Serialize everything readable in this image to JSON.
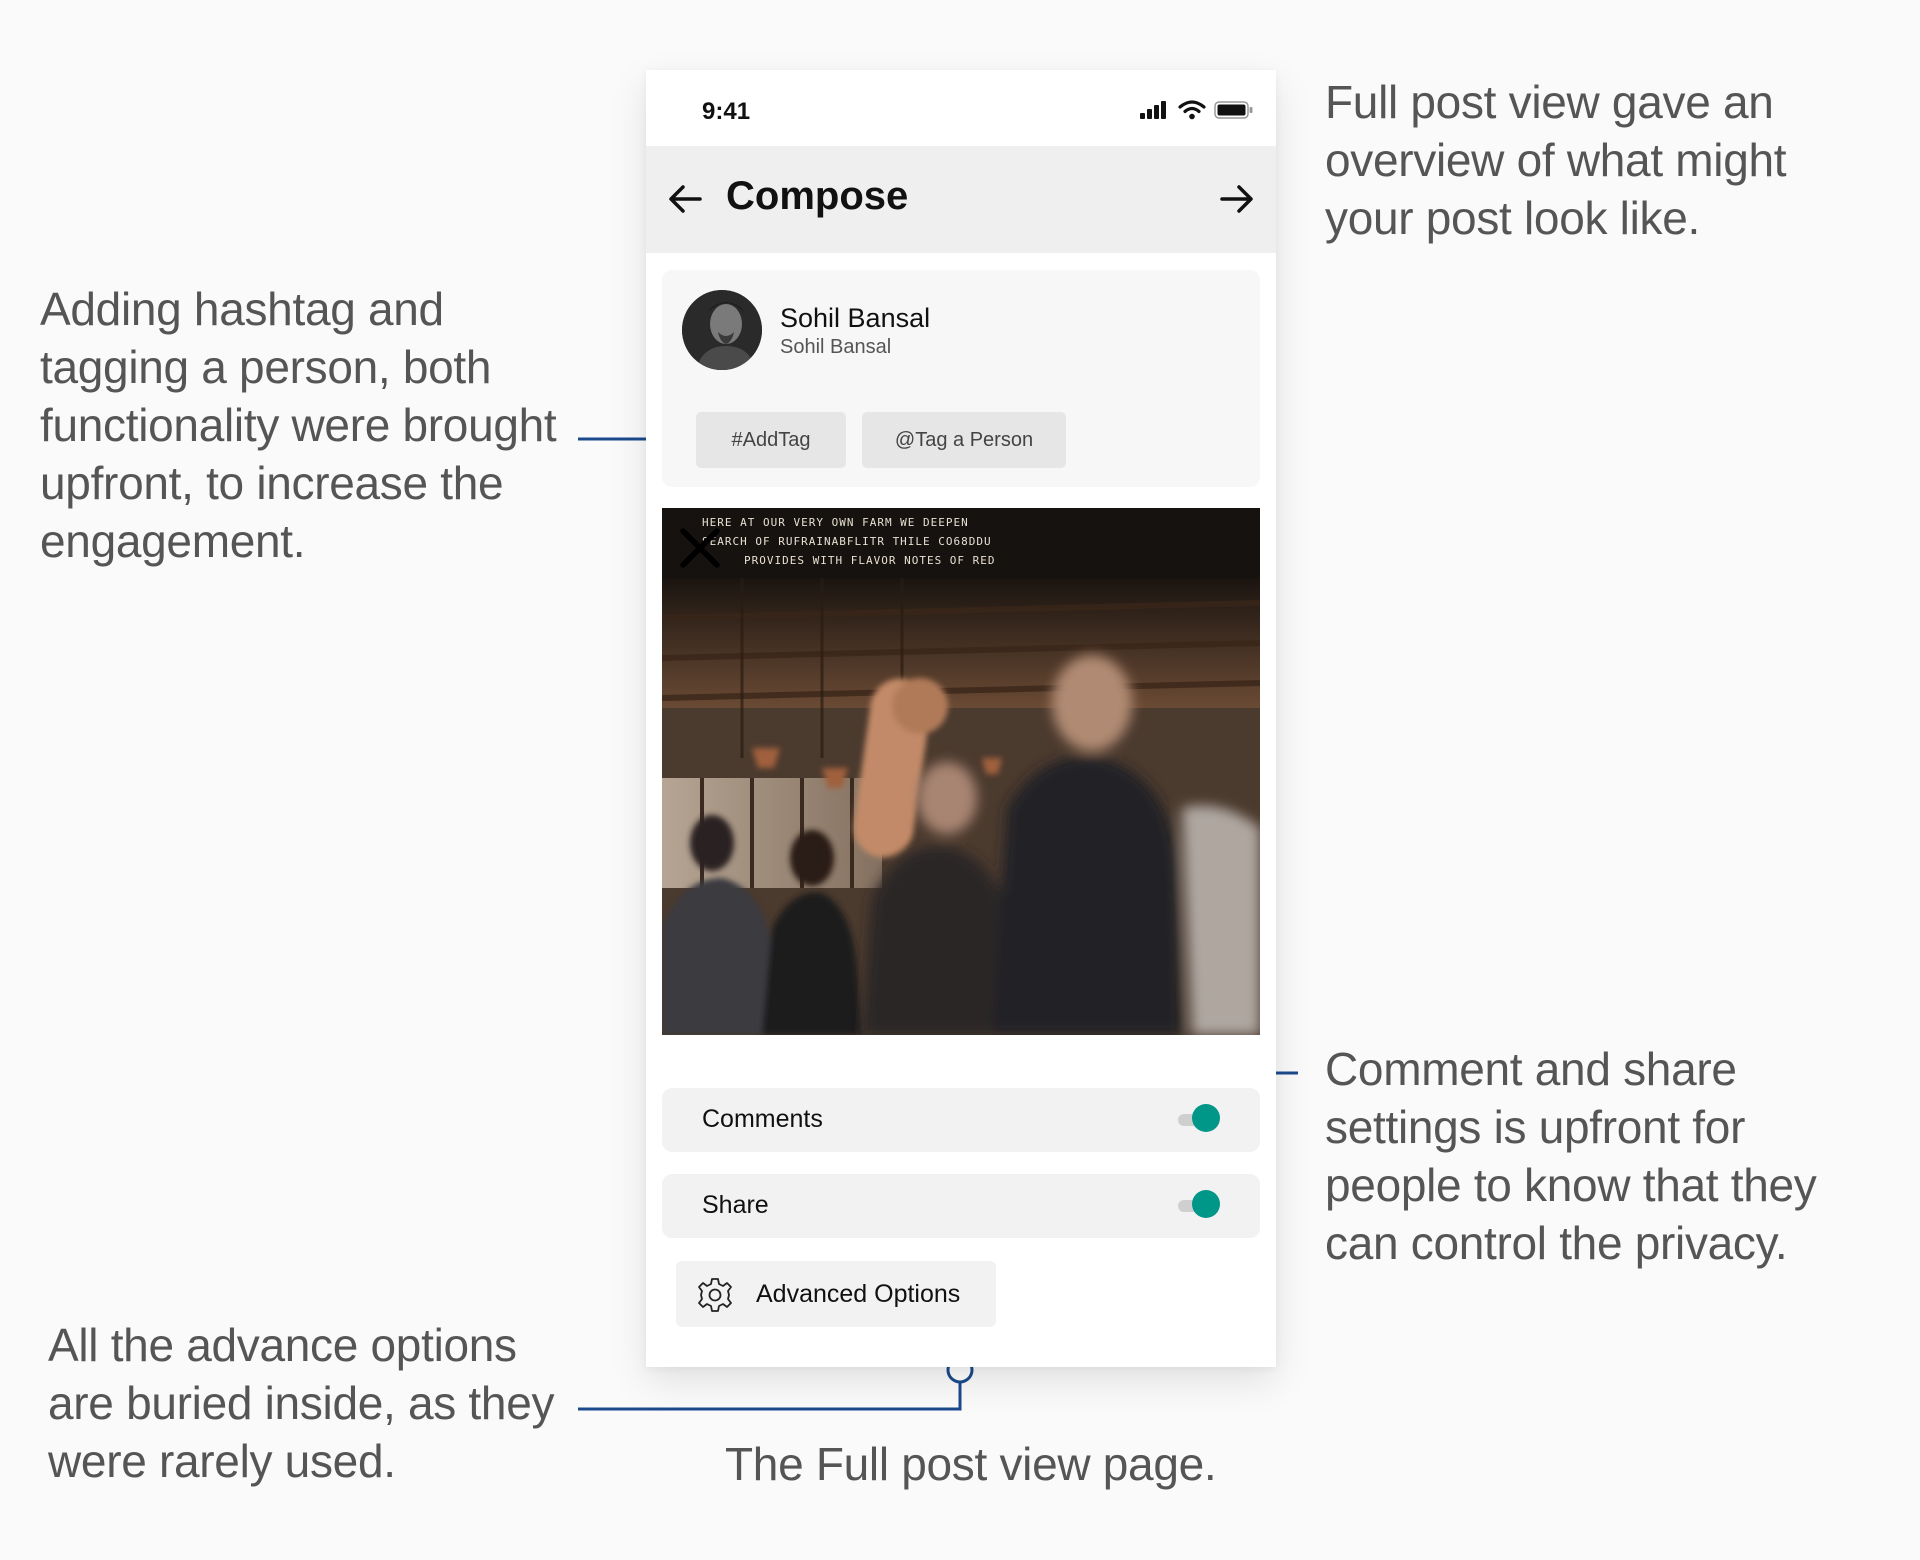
{
  "annotations": {
    "left": [
      "Adding hashtag and",
      "tagging a person, both",
      "functionality were brought",
      "upfront, to increase the",
      "engagement."
    ],
    "top_right": [
      "Full post view gave an",
      "overview of what might",
      "your post look like."
    ],
    "bottom_right": [
      "Comment and share",
      "settings is upfront for",
      "people to know that they",
      "can control the privacy."
    ],
    "bottom_left": [
      "All the advance options",
      "are buried inside, as they",
      "were rarely used."
    ],
    "caption": "The Full post view page."
  },
  "phone": {
    "status": {
      "time": "9:41",
      "icons": [
        "signal-icon",
        "wifi-icon",
        "battery-icon"
      ]
    },
    "appbar": {
      "title": "Compose",
      "back_icon": "arrow-left-icon",
      "forward_icon": "arrow-right-icon"
    },
    "user": {
      "name": "Sohil Bansal",
      "handle": "Sohil Bansal"
    },
    "chips": {
      "hashtag": "#AddTag",
      "tag_person": "@Tag a Person"
    },
    "image": {
      "close_icon": "close-icon",
      "sign_lines": [
        "HERE AT OUR VERY OWN FARM WE DEEPEN",
        "SEARCH OF RUFRAINABFLITR THILE CO68DDU",
        "PROVIDES WITH FLAVOR NOTES OF RED"
      ]
    },
    "toggles": [
      {
        "label": "Comments",
        "on": true
      },
      {
        "label": "Share",
        "on": true
      }
    ],
    "advanced": {
      "label": "Advanced Options",
      "icon": "gear-icon"
    }
  },
  "colors": {
    "accent_connector": "#1a4a8c",
    "toggle_on": "#009688"
  }
}
